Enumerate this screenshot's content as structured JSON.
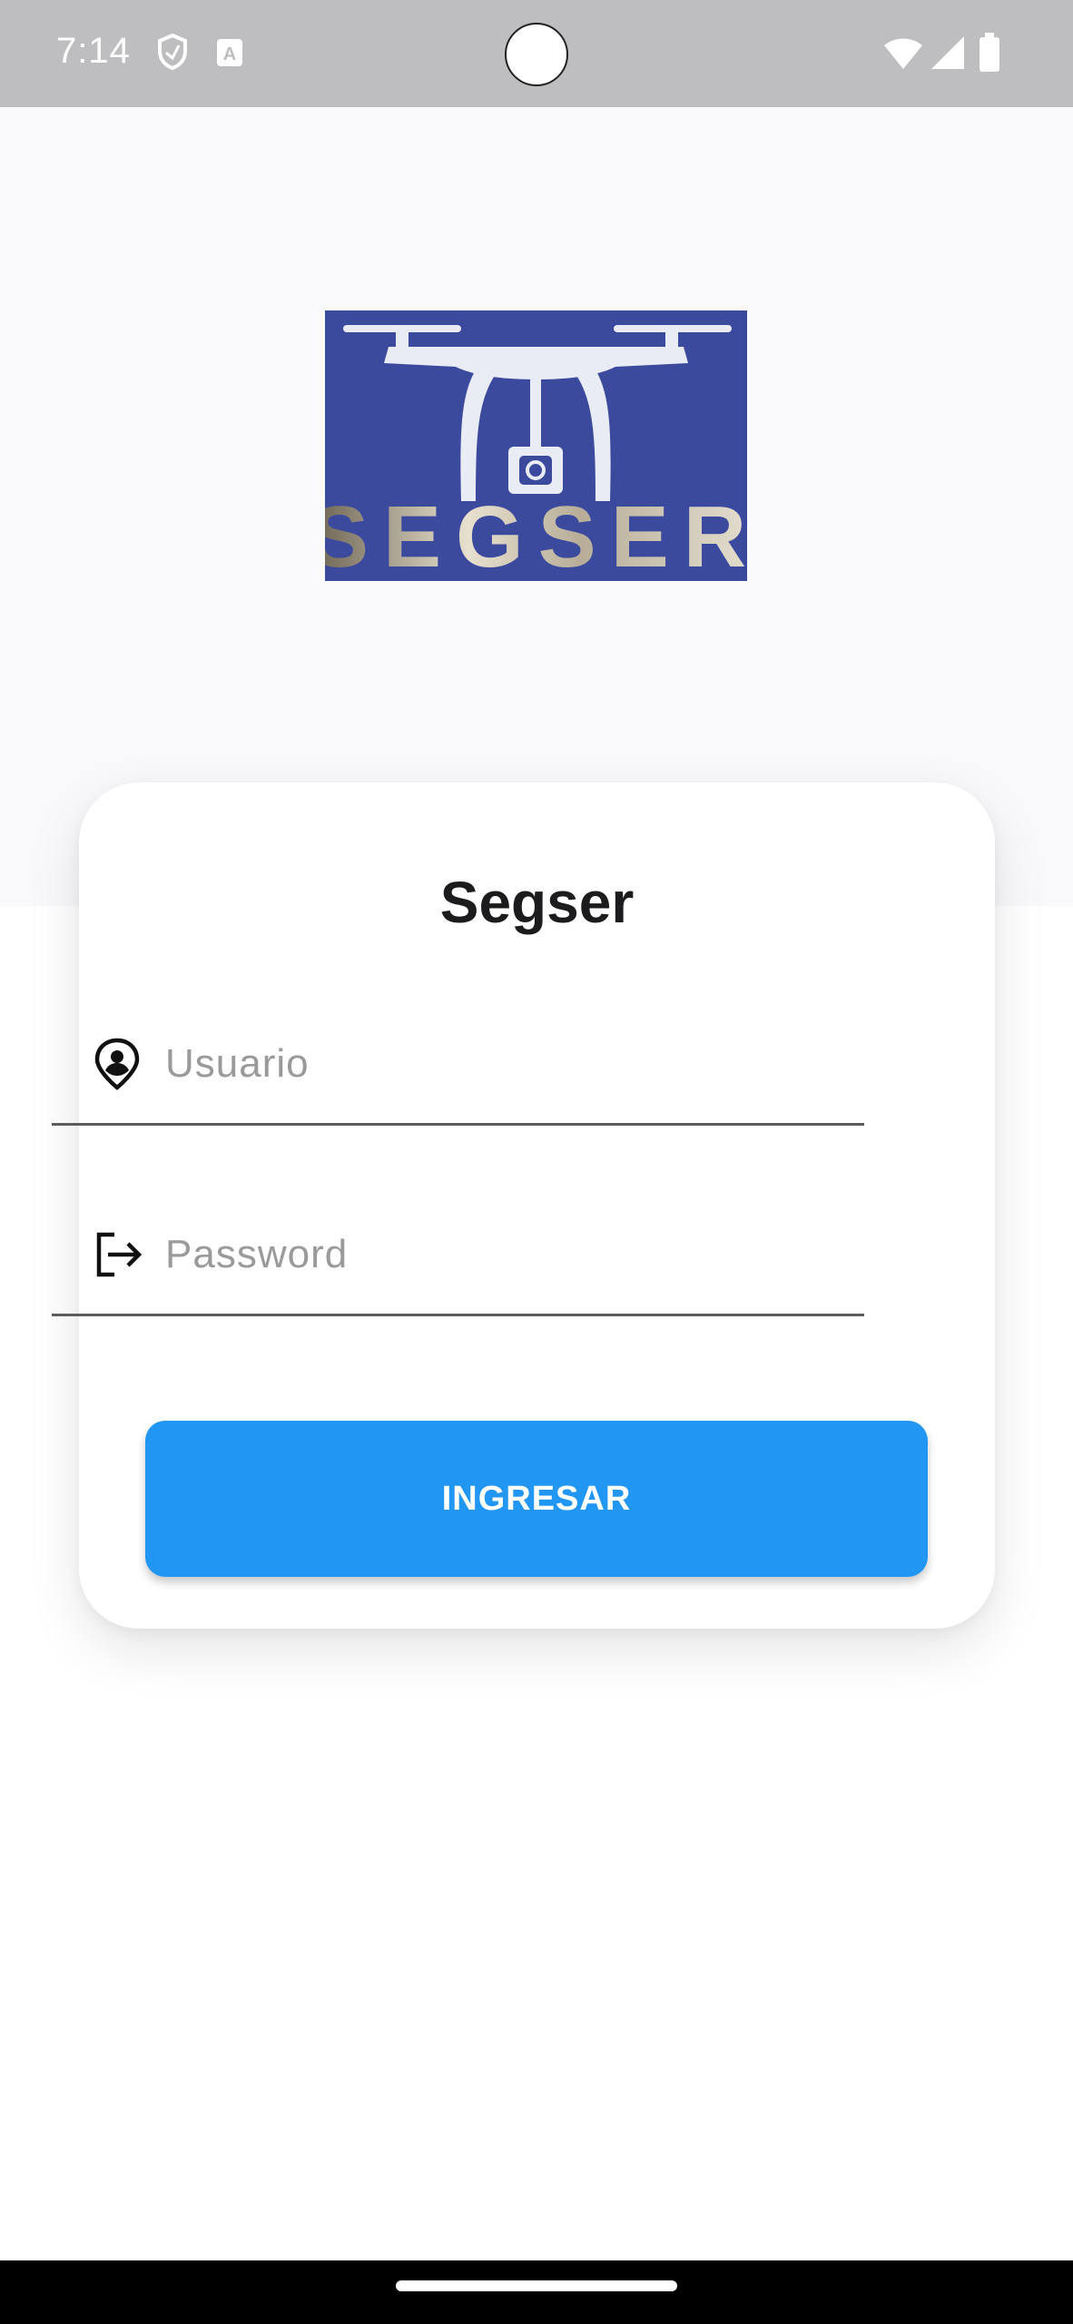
{
  "status_bar": {
    "time": "7:14",
    "icons": [
      "shield-icon",
      "font-a-icon",
      "wifi-icon",
      "signal-icon",
      "battery-icon"
    ]
  },
  "logo": {
    "text": "SEGSER",
    "icon": "drone-camera-icon"
  },
  "login_card": {
    "title": "Segser",
    "username": {
      "placeholder": "Usuario",
      "value": "",
      "icon": "person-pin-icon"
    },
    "password": {
      "placeholder": "Password",
      "value": "",
      "icon": "logout-arrow-icon"
    },
    "submit_label": "INGRESAR"
  },
  "colors": {
    "status_bar": "#bebdbf",
    "header_bg": "#f9f8fb",
    "logo_bg": "#3c4a9e",
    "primary": "#2196f3",
    "field_underline": "#5c5c5c"
  }
}
